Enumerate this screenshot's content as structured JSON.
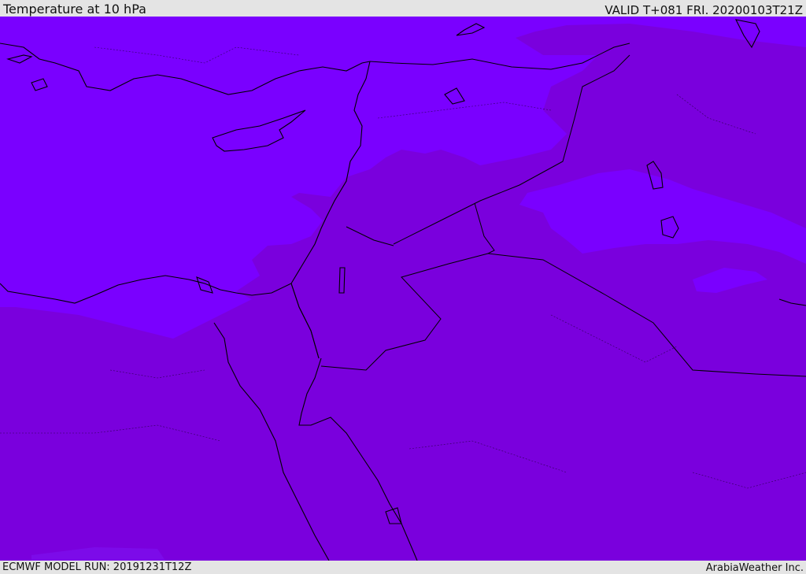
{
  "header": {
    "title": "Temperature at 10 hPa",
    "valid_time": "VALID T+081 FRI. 20200103T21Z"
  },
  "footer": {
    "model_run": "ECMWF MODEL RUN: 20191231T12Z",
    "credit": "ArabiaWeather Inc."
  },
  "map": {
    "field": "temperature",
    "level": "10 hPa",
    "colors": {
      "colder_band": "#7a00ff",
      "warmer_band": "#7a00dd",
      "light_band": "#7e10f0",
      "coastline": "#000000",
      "borders": "#000000"
    }
  }
}
